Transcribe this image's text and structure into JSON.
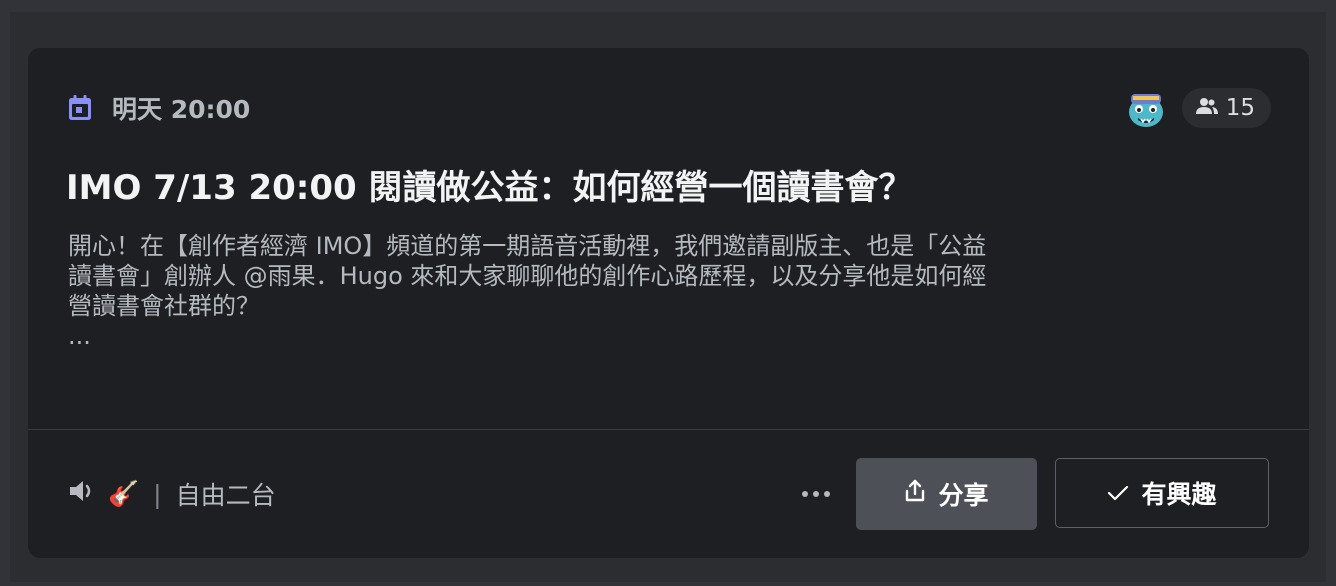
{
  "event": {
    "time": "明天 20:00",
    "title": "IMO 7/13 20:00 閱讀做公益：如何經營一個讀書會？",
    "description": [
      "開心！在【創作者經濟 IMO】頻道的第一期語音活動裡，我們邀請副版主、也是「公益",
      "讀書會」創辦人 @雨果．Hugo 來和大家聊聊他的創作心路歷程，以及分享他是如何經",
      "營讀書會社群的？",
      "..."
    ],
    "attendee_count": "15"
  },
  "channel": {
    "emoji": "🎸",
    "separator": "|",
    "name": "自由二台"
  },
  "actions": {
    "share_label": "分享",
    "interested_label": "有興趣"
  },
  "colors": {
    "accent_calendar": "#8b8ff8",
    "card_background": "#1e1f22",
    "share_button": "#4e5058"
  },
  "icons": {
    "time": "calendar-icon",
    "host": "avatar-monster-icon",
    "attendees": "people-icon",
    "channel": "speaker-icon",
    "more": "more-icon",
    "share": "share-upload-icon",
    "interested": "check-icon"
  }
}
